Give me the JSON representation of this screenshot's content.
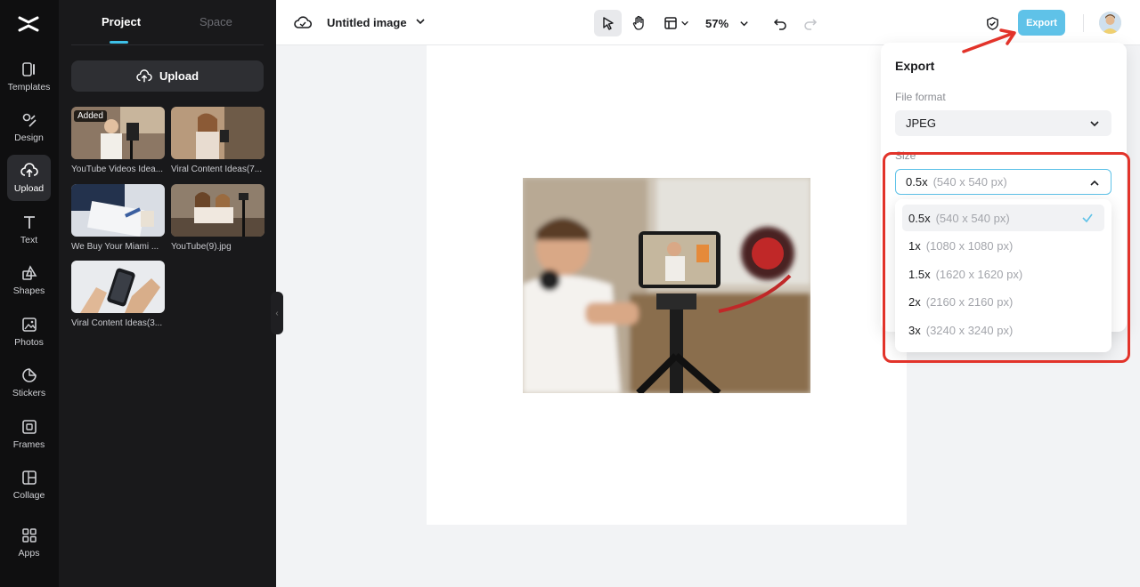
{
  "rail": {
    "items": [
      {
        "label": "Templates",
        "icon": "templates-icon"
      },
      {
        "label": "Design",
        "icon": "design-icon"
      },
      {
        "label": "Upload",
        "icon": "upload-cloud-icon",
        "active": true
      },
      {
        "label": "Text",
        "icon": "text-icon"
      },
      {
        "label": "Shapes",
        "icon": "shapes-icon"
      },
      {
        "label": "Photos",
        "icon": "photos-icon"
      },
      {
        "label": "Stickers",
        "icon": "stickers-icon"
      },
      {
        "label": "Frames",
        "icon": "frames-icon"
      },
      {
        "label": "Collage",
        "icon": "collage-icon"
      },
      {
        "label": "Apps",
        "icon": "apps-icon"
      }
    ]
  },
  "panel": {
    "tabs": [
      "Project",
      "Space"
    ],
    "upload_label": "Upload",
    "assets": [
      {
        "name": "YouTube Videos Idea...",
        "badge": "Added"
      },
      {
        "name": "Viral Content Ideas(7..."
      },
      {
        "name": "We Buy Your Miami ..."
      },
      {
        "name": "YouTube(9).jpg"
      },
      {
        "name": "Viral Content Ideas(3..."
      }
    ]
  },
  "topbar": {
    "title": "Untitled image",
    "zoom": "57%",
    "export_label": "Export"
  },
  "export_panel": {
    "title": "Export",
    "file_format_label": "File format",
    "file_format_value": "JPEG",
    "size_label": "Size",
    "size_value": "0.5x",
    "size_value_px": "(540 x 540 px)",
    "size_options": [
      {
        "scale": "0.5x",
        "px": "(540 x 540 px)",
        "selected": true
      },
      {
        "scale": "1x",
        "px": "(1080 x 1080 px)"
      },
      {
        "scale": "1.5x",
        "px": "(1620 x 1620 px)"
      },
      {
        "scale": "2x",
        "px": "(2160 x 2160 px)"
      },
      {
        "scale": "3x",
        "px": "(3240 x 3240 px)"
      }
    ]
  },
  "colors": {
    "accent": "#5fc2e8",
    "highlight": "#e2332a",
    "rail_bg": "#0f0f10",
    "panel_bg": "#19191b"
  }
}
